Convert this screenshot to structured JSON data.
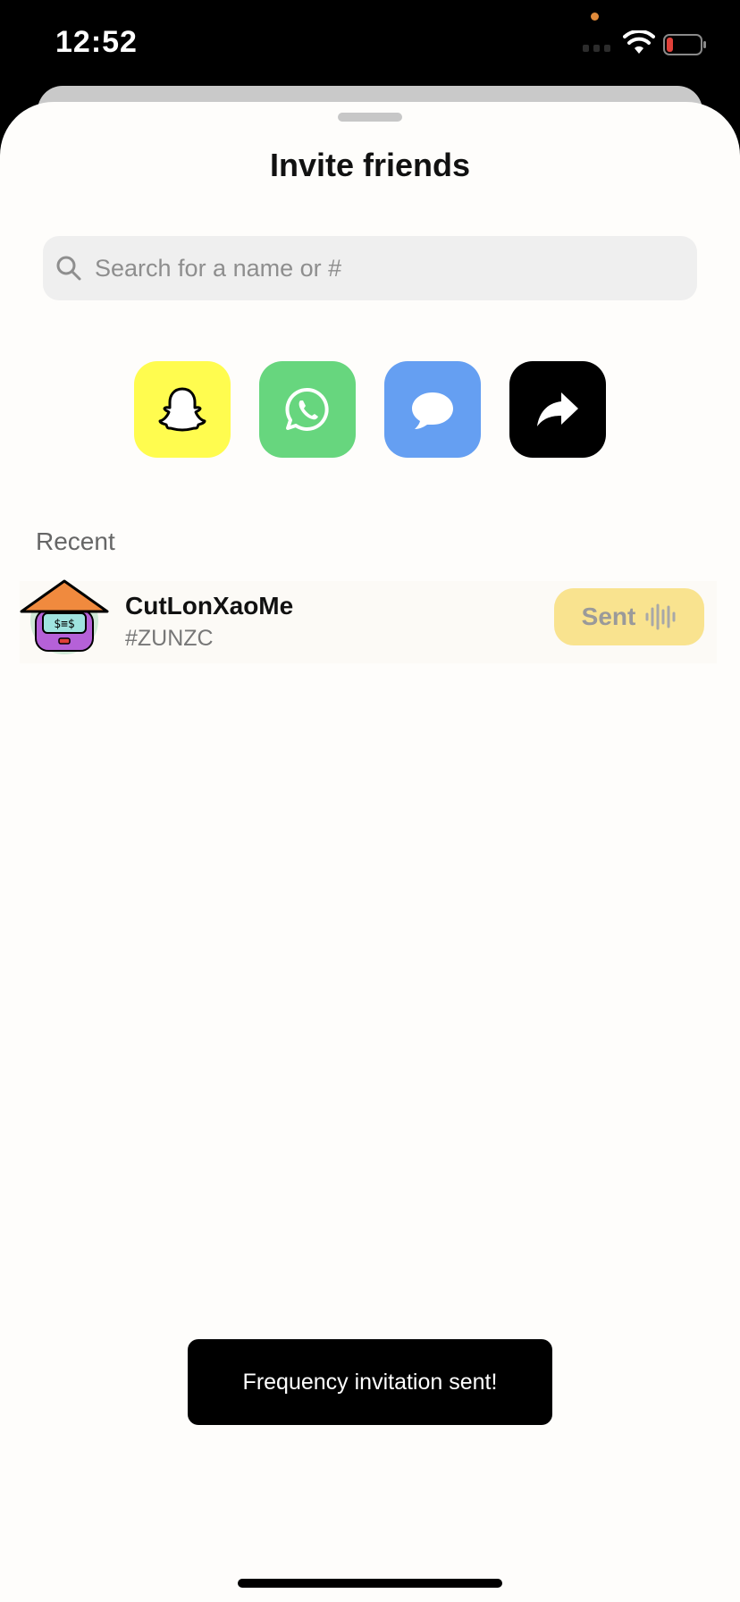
{
  "status_bar": {
    "time": "12:52",
    "battery_color": "#e0413a",
    "privacy_dot_color": "#e08a3a"
  },
  "sheet": {
    "title": "Invite friends",
    "search": {
      "placeholder": "Search for a name or #",
      "value": ""
    },
    "share_options": [
      {
        "name": "snapchat",
        "icon": "snapchat-ghost-icon",
        "color": "#fffc4f"
      },
      {
        "name": "whatsapp",
        "icon": "whatsapp-icon",
        "color": "#67d67e"
      },
      {
        "name": "messages",
        "icon": "message-bubble-icon",
        "color": "#659ff2"
      },
      {
        "name": "share",
        "icon": "share-arrow-icon",
        "color": "#000000"
      }
    ],
    "recent": {
      "label": "Recent",
      "contacts": [
        {
          "name": "CutLonXaoMe",
          "tag": "#ZUNZC",
          "avatar_icon": "conical-hat-avatar",
          "button_label": "Sent",
          "button_color": "#f9e38f"
        }
      ]
    }
  },
  "toast": {
    "message": "Frequency invitation sent!"
  }
}
